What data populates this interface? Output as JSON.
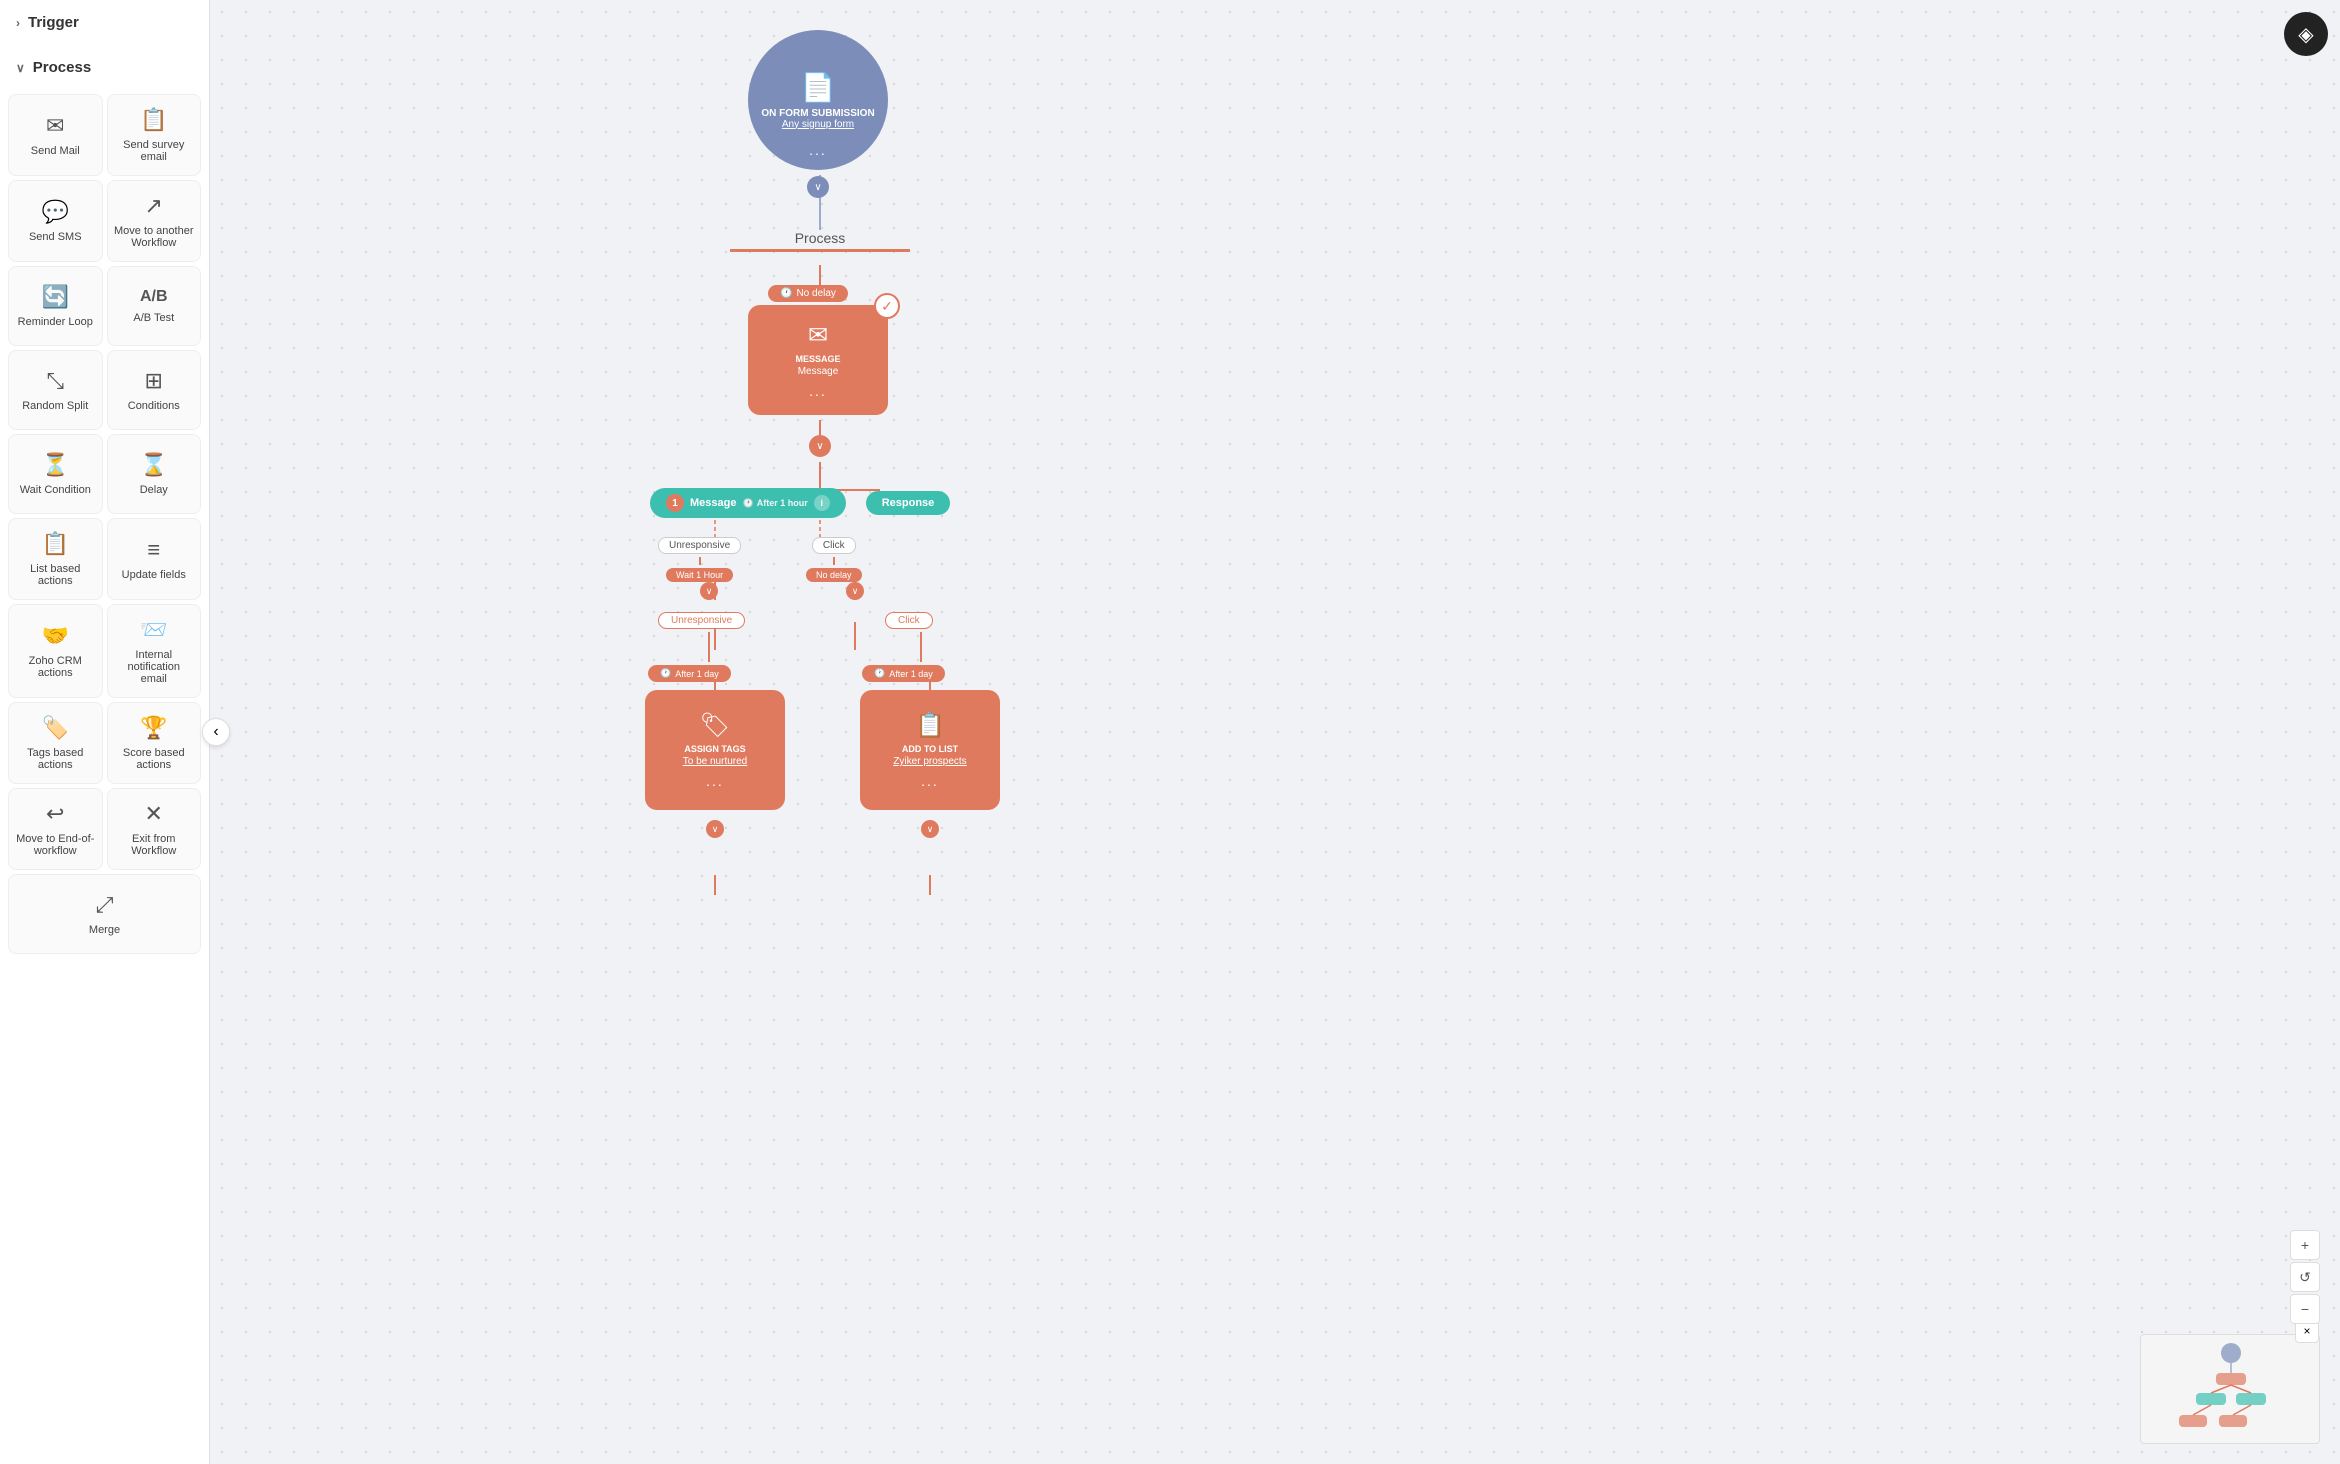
{
  "sidebar": {
    "trigger_label": "Trigger",
    "process_label": "Process",
    "items": [
      {
        "id": "send-mail",
        "label": "Send Mail",
        "icon": "✉️"
      },
      {
        "id": "send-survey-email",
        "label": "Send survey email",
        "icon": "📋"
      },
      {
        "id": "send-sms",
        "label": "Send SMS",
        "icon": "💬"
      },
      {
        "id": "move-to-another-workflow",
        "label": "Move to another Workflow",
        "icon": "↗️"
      },
      {
        "id": "reminder-loop",
        "label": "Reminder Loop",
        "icon": "🔄"
      },
      {
        "id": "ab-test",
        "label": "A/B Test",
        "icon": "A/B"
      },
      {
        "id": "random-split",
        "label": "Random Split",
        "icon": "⤡"
      },
      {
        "id": "conditions",
        "label": "Conditions",
        "icon": "⊞"
      },
      {
        "id": "wait-condition",
        "label": "Wait Condition",
        "icon": "⏳"
      },
      {
        "id": "delay",
        "label": "Delay",
        "icon": "⌛"
      },
      {
        "id": "list-based-actions",
        "label": "List based actions",
        "icon": "📋"
      },
      {
        "id": "update-fields",
        "label": "Update fields",
        "icon": "≡"
      },
      {
        "id": "zoho-crm-actions",
        "label": "Zoho CRM actions",
        "icon": "🤝"
      },
      {
        "id": "internal-notification-email",
        "label": "Internal notification email",
        "icon": "📨"
      },
      {
        "id": "tags-based-actions",
        "label": "Tags based actions",
        "icon": "🏷️"
      },
      {
        "id": "score-based-actions",
        "label": "Score based actions",
        "icon": "🏆"
      },
      {
        "id": "move-to-end-of-workflow",
        "label": "Move to End-of-workflow",
        "icon": "↩️"
      },
      {
        "id": "exit-from-workflow",
        "label": "Exit from Workflow",
        "icon": "✕"
      },
      {
        "id": "merge",
        "label": "Merge",
        "icon": "⤢"
      }
    ]
  },
  "canvas": {
    "trigger_node": {
      "title": "ON FORM SUBMISSION",
      "sub": "Any signup form",
      "dots": "..."
    },
    "process_label": "Process",
    "message_node": {
      "delay_badge": "No delay",
      "title": "MESSAGE",
      "sub": "Message",
      "dots": "..."
    },
    "branch_message": {
      "label": "Message",
      "sub": "After 1 hour",
      "info": "i"
    },
    "branch_response": {
      "label": "Response"
    },
    "unresponsive_wait": {
      "label": "Unresponsive",
      "wait": "Wait 1 Hour"
    },
    "click_nodelay": {
      "label": "Click",
      "wait": "No delay"
    },
    "left_action": {
      "after": "After 1 day",
      "title": "ASSIGN TAGS",
      "sub": "To be nurtured",
      "dots": "..."
    },
    "right_action": {
      "after": "After 1 day",
      "title": "ADD TO LIST",
      "sub": "Zyiker prospects",
      "dots": "..."
    }
  },
  "minimap": {
    "close_label": "×"
  },
  "zoom": {
    "zoom_in_label": "+",
    "zoom_out_label": "−",
    "refresh_label": "↺"
  },
  "top_logo": {
    "icon": "◈"
  },
  "toggle_sidebar": {
    "icon": "‹"
  }
}
